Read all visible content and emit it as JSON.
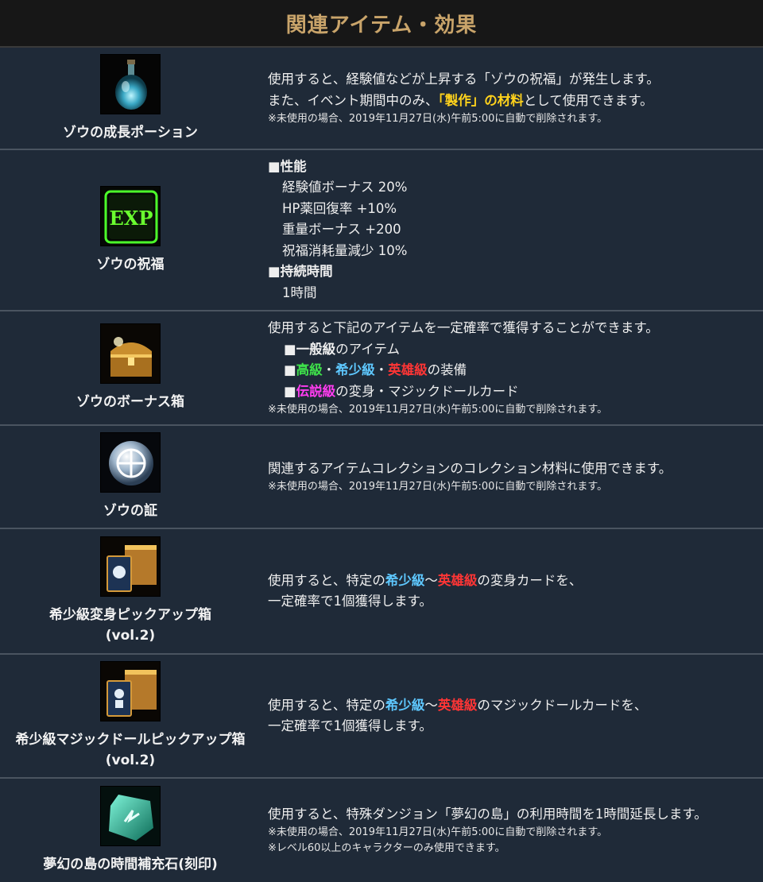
{
  "header": {
    "title": "関連アイテム・効果"
  },
  "items": [
    {
      "name": "ゾウの成長ポーション",
      "icon": "potion-icon",
      "desc1": "使用すると、経験値などが上昇する「ゾウの祝福」が発生します。",
      "desc2_pre": "また、イベント期間中のみ、",
      "desc2_hl": "「製作」の材料",
      "desc2_post": "として使用できます。",
      "note": "※未使用の場合、2019年11月27日(水)午前5:00に自動で削除されます。"
    },
    {
      "name": "ゾウの祝福",
      "icon": "exp-icon",
      "sec1": "■性能",
      "stats": [
        "経験値ボーナス 20%",
        "HP薬回復率 +10%",
        "重量ボーナス +200",
        "祝福消耗量減少 10%"
      ],
      "sec2": "■持続時間",
      "duration": "1時間"
    },
    {
      "name": "ゾウのボーナス箱",
      "icon": "treasure-chest-icon",
      "desc1": "使用すると下記のアイテムを一定確率で獲得することができます。",
      "sq": "■",
      "b1_hl": "一般級",
      "b1_post": "のアイテム",
      "b2_g": "高級",
      "dot": "・",
      "b2_b": "希少級",
      "b2_r": "英雄級",
      "b2_post": "の装備",
      "b3_m": "伝説級",
      "b3_post": "の変身・マジックドールカード",
      "note": "※未使用の場合、2019年11月27日(水)午前5:00に自動で削除されます。"
    },
    {
      "name": "ゾウの証",
      "icon": "medal-icon",
      "desc1": "関連するアイテムコレクションのコレクション材料に使用できます。",
      "note": "※未使用の場合、2019年11月27日(水)午前5:00に自動で削除されます。"
    },
    {
      "name": "希少級変身ピックアップ箱\n(vol.2)",
      "icon": "card-chest-icon",
      "d1_pre": "使用すると、特定の",
      "d1_b": "希少級",
      "tilde": "～",
      "d1_r": "英雄級",
      "d1_post": "の変身カードを、",
      "d2": "一定確率で1個獲得します。"
    },
    {
      "name": "希少級マジックドールピックアップ箱\n(vol.2)",
      "icon": "doll-chest-icon",
      "d1_pre": "使用すると、特定の",
      "d1_b": "希少級",
      "tilde": "～",
      "d1_r": "英雄級",
      "d1_post": "のマジックドールカードを、",
      "d2": "一定確率で1個獲得します。"
    },
    {
      "name": "夢幻の島の時間補充石(刻印)",
      "icon": "gem-icon",
      "desc1": "使用すると、特殊ダンジョン「夢幻の島」の利用時間を1時間延長します。",
      "note": "※未使用の場合、2019年11月27日(水)午前5:00に自動で削除されます。",
      "note2": "※レベル60以上のキャラクターのみ使用できます。"
    }
  ]
}
